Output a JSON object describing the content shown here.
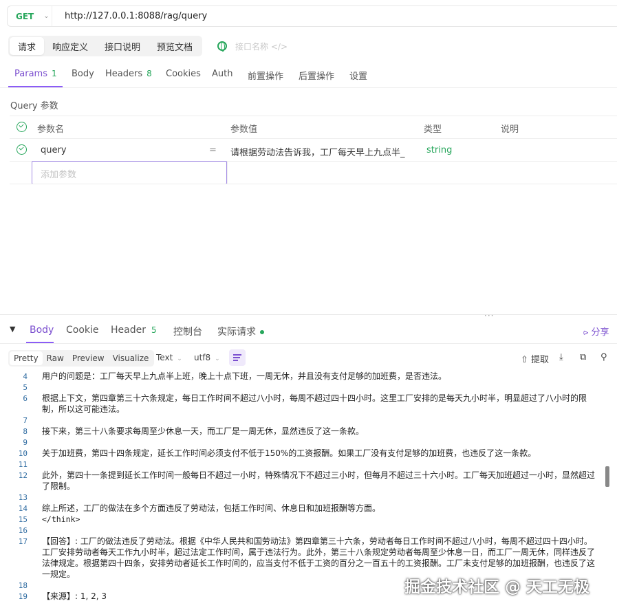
{
  "request": {
    "method": "GET",
    "url": "http://127.0.0.1:8088/rag/query"
  },
  "doc_tabs": [
    "请求",
    "响应定义",
    "接口说明",
    "预览文档"
  ],
  "interface_name_placeholder": "接口名称",
  "param_tabs": [
    {
      "label": "Params",
      "count": "1"
    },
    {
      "label": "Body",
      "count": ""
    },
    {
      "label": "Headers",
      "count": "8"
    },
    {
      "label": "Cookies",
      "count": ""
    },
    {
      "label": "Auth",
      "count": ""
    },
    {
      "label": "前置操作",
      "count": ""
    },
    {
      "label": "后置操作",
      "count": ""
    },
    {
      "label": "设置",
      "count": ""
    }
  ],
  "query_title": "Query 参数",
  "param_table": {
    "headers": [
      "参数名",
      "参数值",
      "类型",
      "说明"
    ],
    "rows": [
      {
        "name": "query",
        "op": "=",
        "value": "请根据劳动法告诉我，工厂每天早上九点半_",
        "type": "string",
        "desc": ""
      }
    ],
    "add_placeholder": "添加参数"
  },
  "response_tabs": [
    {
      "label": "Body",
      "count": ""
    },
    {
      "label": "Cookie",
      "count": ""
    },
    {
      "label": "Header",
      "count": "5"
    },
    {
      "label": "控制台",
      "count": ""
    },
    {
      "label": "实际请求",
      "count": ""
    }
  ],
  "share_label": "分享",
  "format_buttons": [
    "Pretty",
    "Raw",
    "Preview",
    "Visualize"
  ],
  "format_select": "Text",
  "encoding_select": "utf8",
  "extract_label": "提取",
  "code_lines": [
    {
      "n": "4",
      "text": "用户的问题是：工厂每天早上九点半上班，晚上十点下班，一周无休，并且没有支付足够的加班费，是否违法。"
    },
    {
      "n": "5",
      "text": ""
    },
    {
      "n": "6",
      "text": "根据上下文，第四章第三十六条规定，每日工作时间不超过八小时，每周不超过四十四小时。这里工厂安排的是每天九小时半，明显超过了八小时的限制，所以这可能违法。"
    },
    {
      "n": "7",
      "text": ""
    },
    {
      "n": "8",
      "text": "接下来，第三十八条要求每周至少休息一天，而工厂是一周无休，显然违反了这一条款。"
    },
    {
      "n": "9",
      "text": ""
    },
    {
      "n": "10",
      "text": "关于加班费，第四十四条规定，延长工作时间必须支付不低于150%的工资报酬。如果工厂没有支付足够的加班费，也违反了这一条款。"
    },
    {
      "n": "11",
      "text": ""
    },
    {
      "n": "12",
      "text": "此外，第四十一条提到延长工作时间一般每日不超过一小时，特殊情况下不超过三小时，但每月不超过三十六小时。工厂每天加班超过一小时，显然超过了限制。"
    },
    {
      "n": "13",
      "text": ""
    },
    {
      "n": "14",
      "text": "综上所述，工厂的做法在多个方面违反了劳动法，包括工作时间、休息日和加班报酬等方面。"
    },
    {
      "n": "15",
      "text": "</think>"
    },
    {
      "n": "16",
      "text": ""
    },
    {
      "n": "17",
      "text": "【回答】: 工厂的做法违反了劳动法。根据《中华人民共和国劳动法》第四章第三十六条，劳动者每日工作时间不超过八小时，每周不超过四十四小时。工厂安排劳动者每天工作九小时半，超过法定工作时间，属于违法行为。此外，第三十八条规定劳动者每周至少休息一日，而工厂一周无休，同样违反了法律规定。根据第四十四条，安排劳动者延长工作时间的，应当支付不低于工资的百分之一百五十的工资报酬。工厂未支付足够的加班报酬，也违反了这一规定。"
    },
    {
      "n": "18",
      "text": ""
    },
    {
      "n": "19",
      "text": "【来源】: 1, 2, 3"
    }
  ],
  "watermark": "掘金技术社区 @ 天工无极"
}
